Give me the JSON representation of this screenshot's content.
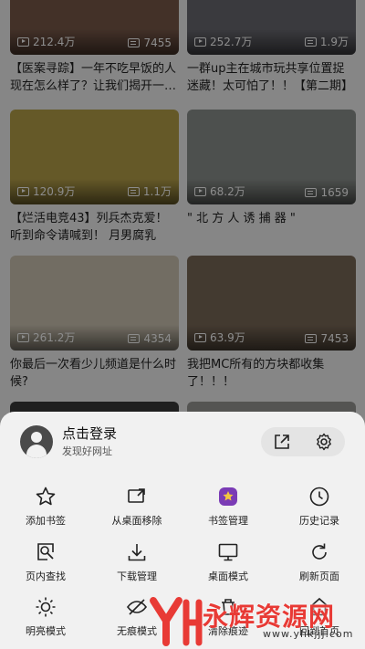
{
  "feed": {
    "videos": [
      {
        "views": "212.4万",
        "danmaku": "7455",
        "title": "【医案寻踪】一年不吃早饭的人现在怎么样了？让我们揭开一…",
        "thumb_color": "#7a5a4a"
      },
      {
        "views": "252.7万",
        "danmaku": "1.9万",
        "title": "一群up主在城市玩共享位置捉迷藏！太可怕了！！【第二期】",
        "thumb_color": "#6b6b72"
      },
      {
        "views": "120.9万",
        "danmaku": "1.1万",
        "title": "【烂活电竞43】列兵杰克爱！听到命令请喊到！ 月男腐乳杰…",
        "thumb_color": "#b8a24a"
      },
      {
        "views": "68.2万",
        "danmaku": "1659",
        "title": "\" 北 方 人 诱 捕 器 \"",
        "thumb_color": "#8d928e"
      },
      {
        "views": "261.2万",
        "danmaku": "4354",
        "title": "你最后一次看少儿频道是什么时候?",
        "thumb_color": "#cfc6b4"
      },
      {
        "views": "63.9万",
        "danmaku": "7453",
        "title": "我把MC所有的方块都收集了！！！",
        "thumb_color": "#7b6a58"
      }
    ]
  },
  "menu": {
    "login_title": "点击登录",
    "login_sub": "发现好网址",
    "items": [
      {
        "label": "添加书签",
        "icon": "star-icon"
      },
      {
        "label": "从桌面移除",
        "icon": "desktop-remove-icon"
      },
      {
        "label": "书签管理",
        "icon": "bookmark-manager-icon"
      },
      {
        "label": "历史记录",
        "icon": "clock-icon"
      },
      {
        "label": "页内查找",
        "icon": "find-in-page-icon"
      },
      {
        "label": "下载管理",
        "icon": "download-icon"
      },
      {
        "label": "桌面模式",
        "icon": "monitor-icon"
      },
      {
        "label": "刷新页面",
        "icon": "refresh-icon"
      },
      {
        "label": "明亮模式",
        "icon": "sun-icon"
      },
      {
        "label": "无痕模式",
        "icon": "incognito-icon"
      },
      {
        "label": "清除痕迹",
        "icon": "clear-icon"
      },
      {
        "label": "回到首页",
        "icon": "home-icon"
      }
    ]
  },
  "watermark": {
    "text": "永辉资源网",
    "url": "www.yhkjjj.com"
  }
}
